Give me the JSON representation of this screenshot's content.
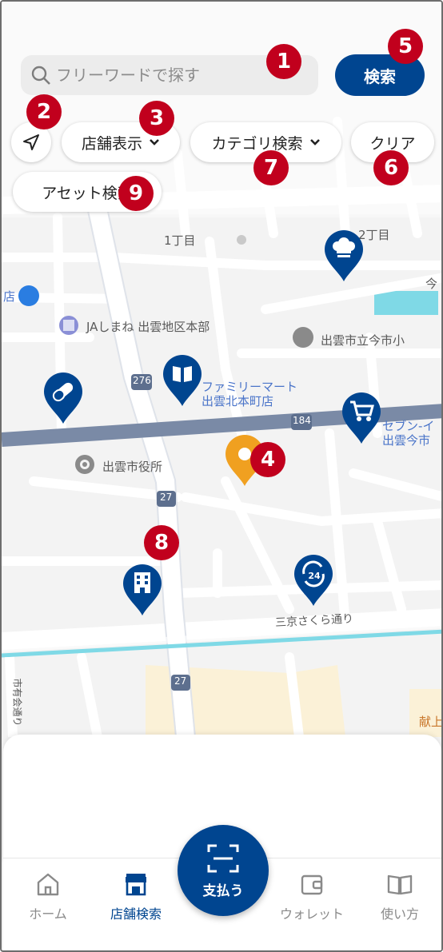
{
  "search": {
    "placeholder": "フリーワードで探す",
    "button_label": "検索"
  },
  "chips": {
    "store_display": "店舗表示",
    "category_search": "カテゴリ検索",
    "clear": "クリア",
    "asset_search": "アセット検索"
  },
  "badges": [
    "1",
    "2",
    "3",
    "4",
    "5",
    "6",
    "7",
    "8",
    "9"
  ],
  "map_labels": {
    "chome": "1丁目",
    "chome2": "2丁目",
    "ima": "今",
    "ja": "JAしまね 出雲地区本部",
    "school": "出雲市立今市小",
    "famima1": "ファミリーマート",
    "famima2": "出雲北本町店",
    "seven1": "セブン-イ",
    "seven2": "出雲今市",
    "cityhall": "出雲市役所",
    "route276": "276",
    "route184": "184",
    "route27a": "27",
    "route27b": "27",
    "street": "三京さくら通り",
    "left_edge": "店",
    "bottom_right": "献上",
    "left_vertical": "市有会通り"
  },
  "tabs": [
    {
      "label": "ホーム",
      "icon": "home-icon"
    },
    {
      "label": "店舗検索",
      "icon": "store-icon"
    },
    {
      "label": "ウォレット",
      "icon": "wallet-icon"
    },
    {
      "label": "使い方",
      "icon": "book-icon"
    }
  ],
  "pay": {
    "label": "支払う",
    "icon": "scan-icon"
  },
  "colors": {
    "primary": "#004590",
    "badge": "#c1001d",
    "pin_selected": "#f0a020",
    "map_bg": "#f2f2f2"
  },
  "pins": [
    "chef-hat-icon",
    "pill-icon",
    "book-pin-icon",
    "cart-icon",
    "location-selected-icon",
    "building-icon",
    "24h-icon"
  ]
}
